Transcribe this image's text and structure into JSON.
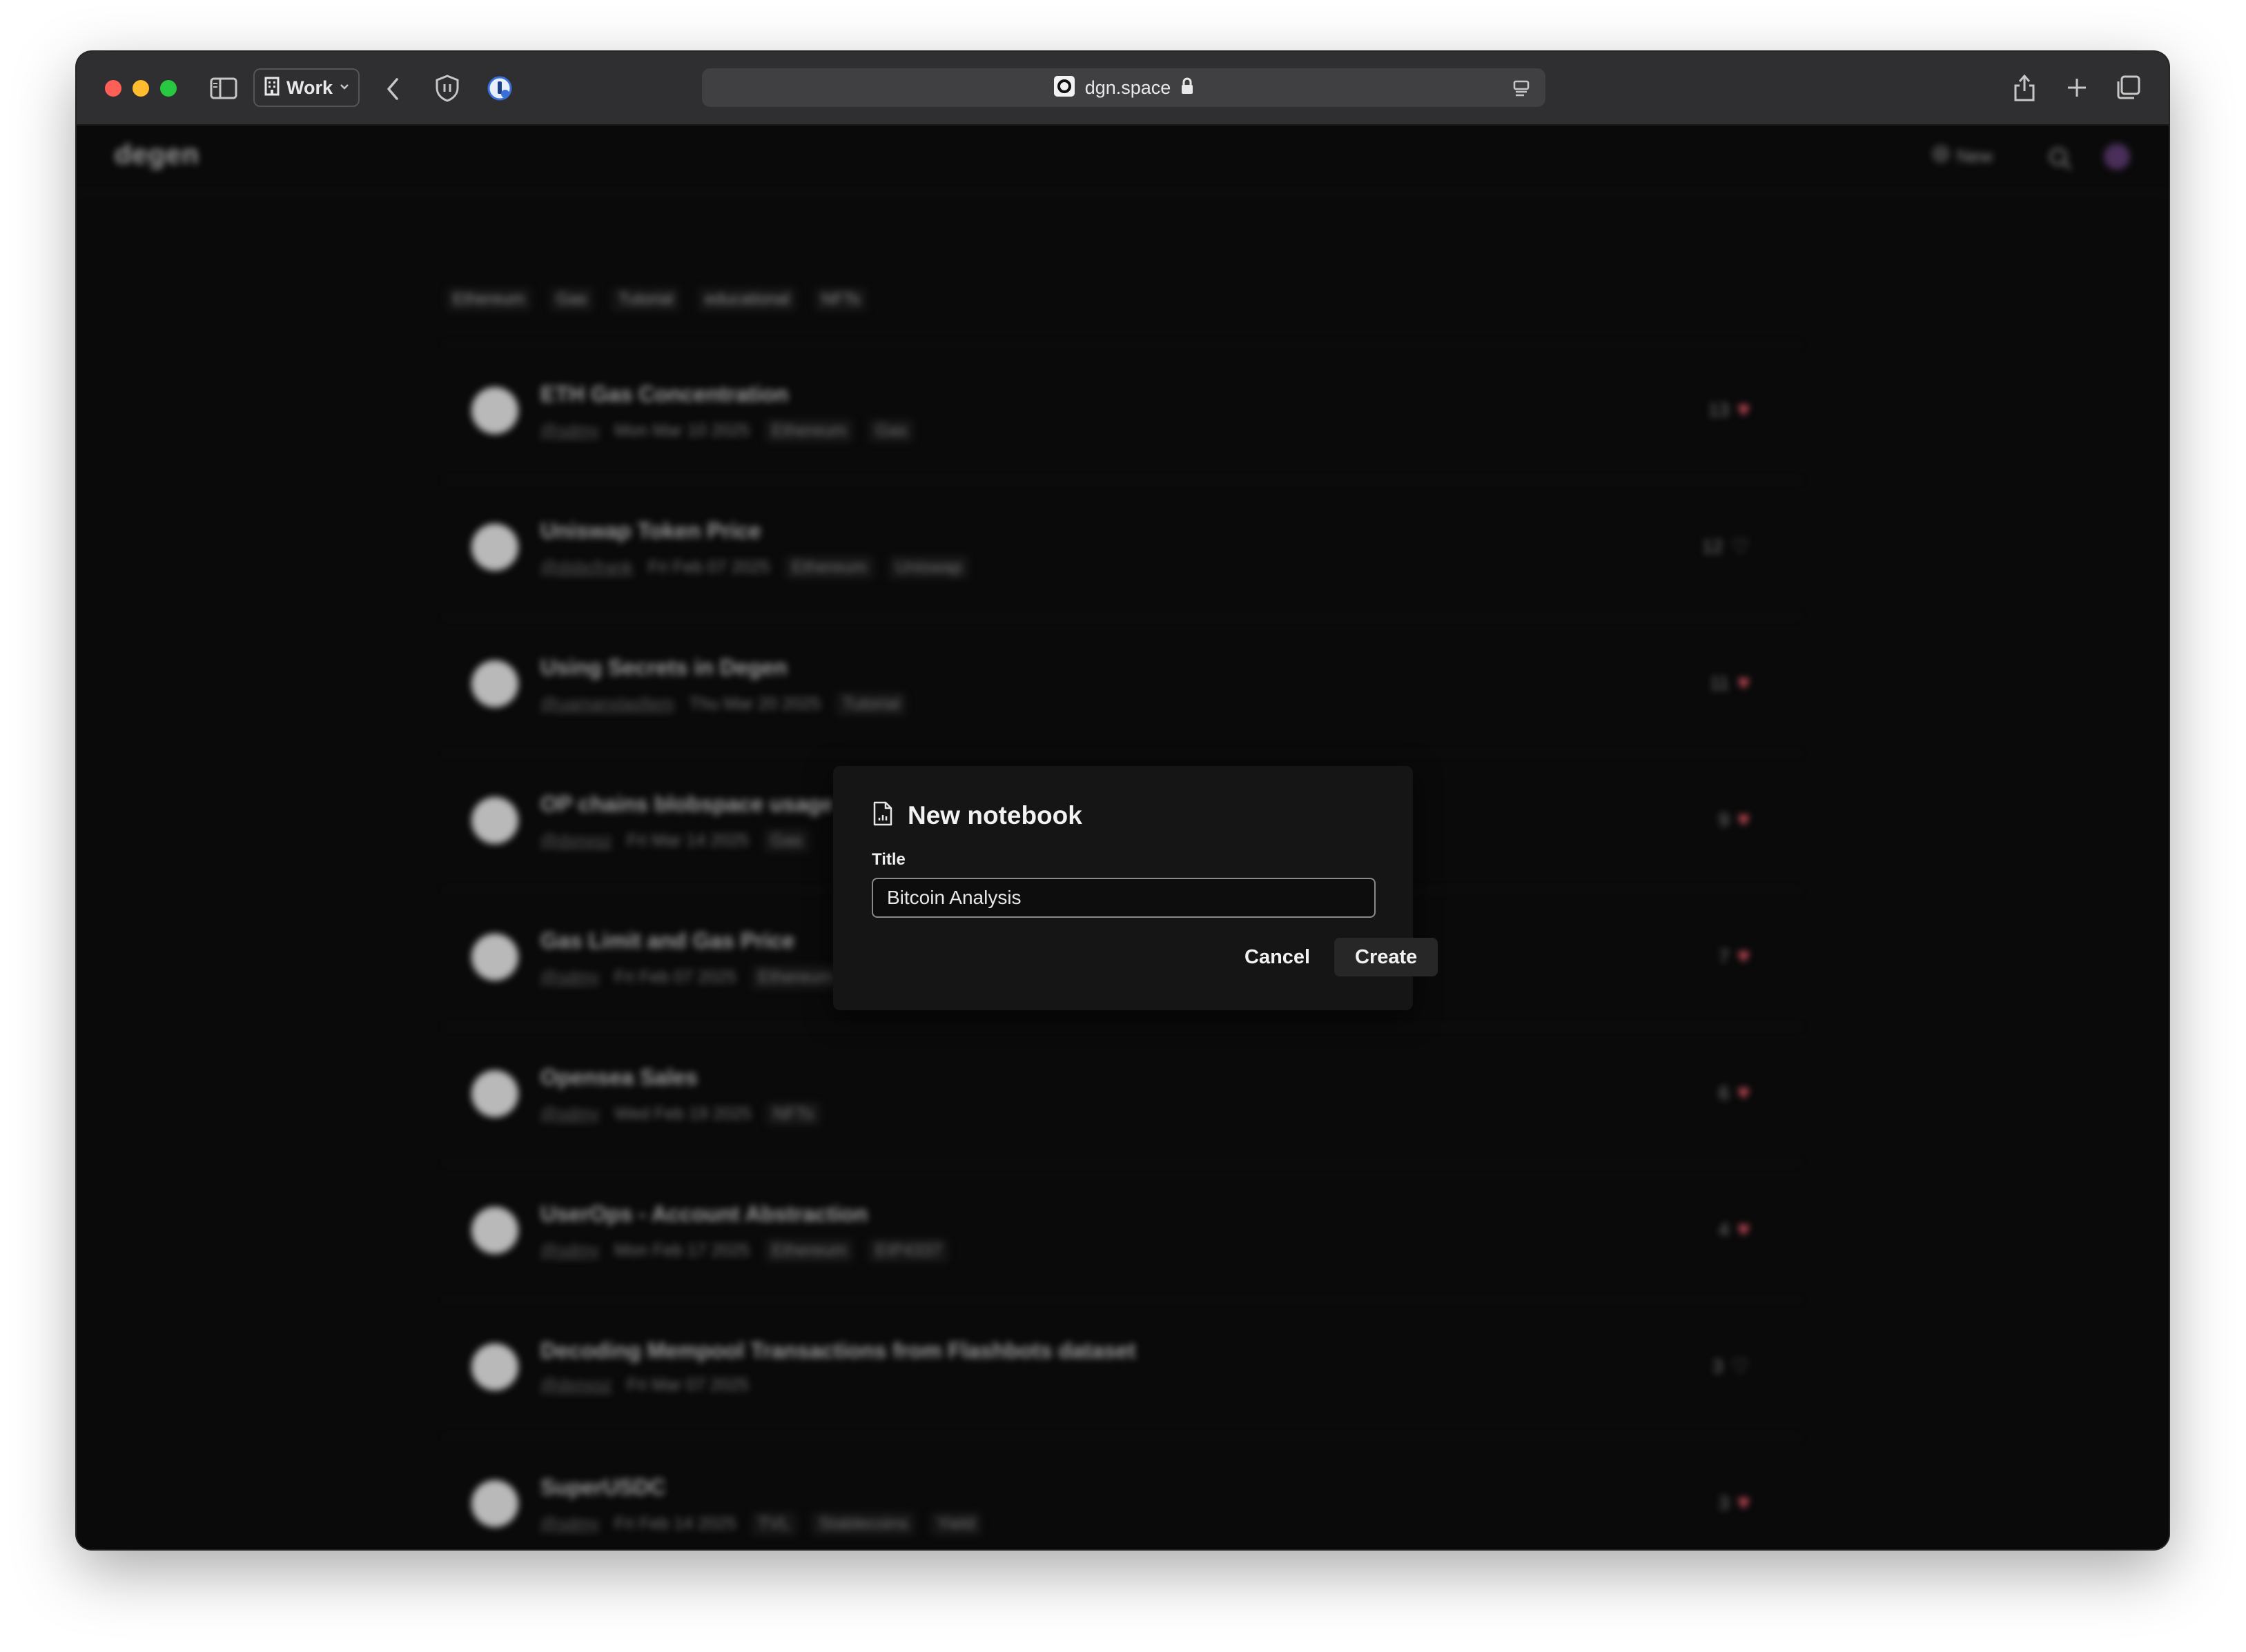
{
  "browser": {
    "profile_label": "Work",
    "url": "dgn.space"
  },
  "site": {
    "logo": "degen",
    "new_label": "New",
    "tag_filters": [
      "Ethereum",
      "Gas",
      "Tutorial",
      "educational",
      "NFTs"
    ]
  },
  "notebooks": [
    {
      "title": "ETH Gas Concentration",
      "author": "@sdmy",
      "date": "Mon Mar 10 2025",
      "tags": [
        "Ethereum",
        "Gas"
      ],
      "likes": "13",
      "liked": true
    },
    {
      "title": "Uniswap Token Price",
      "author": "@dsbcfrank",
      "date": "Fri Feb 07 2025",
      "tags": [
        "Ethereum",
        "Uniswap"
      ],
      "likes": "12",
      "liked": false
    },
    {
      "title": "Using Secrets in Degen",
      "author": "@uamanxlasfiem",
      "date": "Thu Mar 20 2025",
      "tags": [
        "Tutorial"
      ],
      "likes": "11",
      "liked": true
    },
    {
      "title": "OP chains blobspace usage",
      "author": "@dxnxsz",
      "date": "Fri Mar 14 2025",
      "tags": [
        "Gas"
      ],
      "likes": "9",
      "liked": true
    },
    {
      "title": "Gas Limit and Gas Price",
      "author": "@sdmy",
      "date": "Fri Feb 07 2025",
      "tags": [
        "Ethereum"
      ],
      "likes": "7",
      "liked": true
    },
    {
      "title": "Opensea Sales",
      "author": "@sdmy",
      "date": "Wed Feb 19 2025",
      "tags": [
        "NFTs"
      ],
      "likes": "6",
      "liked": true
    },
    {
      "title": "UserOps - Account Abstraction",
      "author": "@sdmy",
      "date": "Mon Feb 17 2025",
      "tags": [
        "Ethereum",
        "EIP4337"
      ],
      "likes": "4",
      "liked": true
    },
    {
      "title": "Decoding Mempool Transactions from Flashbots dataset",
      "author": "@dxnxsz",
      "date": "Fri Mar 07 2025",
      "tags": [],
      "likes": "3",
      "liked": false
    },
    {
      "title": "SuperUSDC",
      "author": "@sdmy",
      "date": "Fri Feb 14 2025",
      "tags": [
        "TVL",
        "Stablecoins",
        "Yield"
      ],
      "likes": "3",
      "liked": true
    }
  ],
  "modal": {
    "title": "New notebook",
    "field_label": "Title",
    "title_value": "Bitcoin Analysis",
    "cancel_label": "Cancel",
    "create_label": "Create"
  },
  "colors": {
    "accent_like": "#c74b5a",
    "background": "#0a0a0a",
    "modal_bg": "#151515"
  }
}
